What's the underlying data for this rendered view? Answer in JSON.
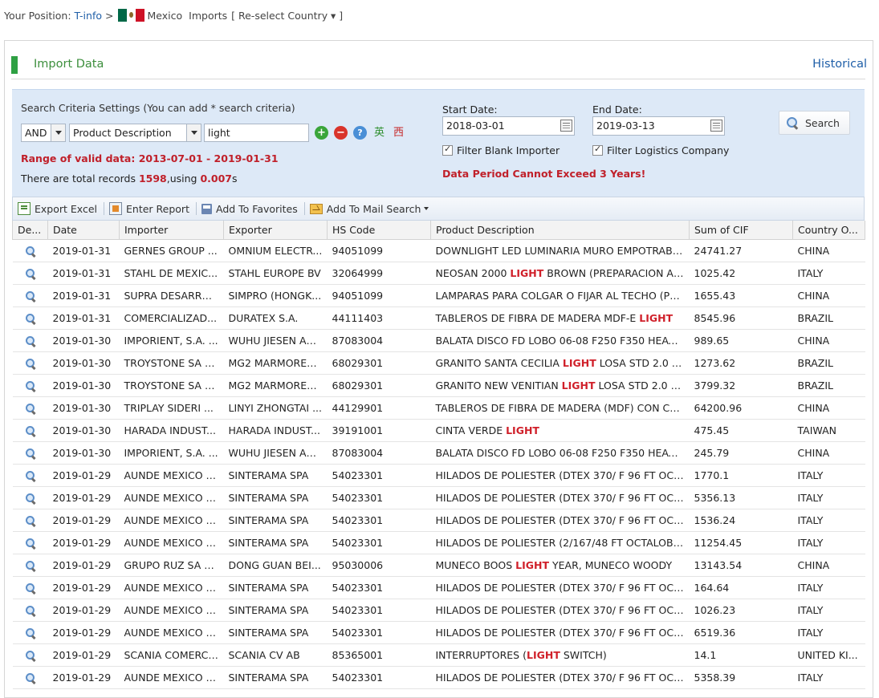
{
  "breadcrumb": {
    "prefix": "Your Position:",
    "home": "T-info",
    "separator": ">",
    "country": "Mexico",
    "section": "Imports",
    "reselect": "[ Re-select Country ▾ ]"
  },
  "panel": {
    "title": "Import Data",
    "historical": "Historical"
  },
  "criteria": {
    "title": "Search Criteria Settings (You can add * search criteria)",
    "logic_value": "AND",
    "field_value": "Product Description",
    "keyword_value": "light",
    "lang_en": "英",
    "lang_es": "西",
    "valid_range": "Range of valid data: 2013-07-01 - 2019-01-31",
    "records_prefix": "There are total records ",
    "records_count": "1598",
    "records_mid": ",using ",
    "records_time": "0.007",
    "records_suffix": "s",
    "start_label": "Start Date:",
    "start_value": "2018-03-01",
    "end_label": "End Date:",
    "end_value": "2019-03-13",
    "filter_blank": "Filter Blank Importer",
    "filter_logistics": "Filter Logistics Company",
    "period_warning": "Data Period Cannot Exceed 3 Years!",
    "search_label": "Search"
  },
  "toolbar": {
    "export": "Export Excel",
    "report": "Enter Report",
    "favorites": "Add To Favorites",
    "mail": "Add To Mail Search"
  },
  "table": {
    "headers": [
      "De...",
      "Date",
      "Importer",
      "Exporter",
      "HS Code",
      "Product Description",
      "Sum of CIF",
      "Country O..."
    ],
    "rows": [
      {
        "date": "2019-01-31",
        "importer": "GERNES GROUP ...",
        "exporter": "OMNIUM ELECTR...",
        "hs": "94051099",
        "desc": [
          "DOWNLIGHT LED LUMINARIA MURO EMPOTRABL..."
        ],
        "cif": "24741.27",
        "country": "CHINA"
      },
      {
        "date": "2019-01-31",
        "importer": "STAHL DE MEXIC...",
        "exporter": "STAHL EUROPE BV",
        "hs": "32064999",
        "desc": [
          "NEOSAN 2000 ",
          "LIGHT",
          " BROWN (PREPARACION A B..."
        ],
        "cif": "1025.42",
        "country": "ITALY"
      },
      {
        "date": "2019-01-31",
        "importer": "SUPRA DESARRO...",
        "exporter": "SIMPRO (HONGK...",
        "hs": "94051099",
        "desc": [
          "LAMPARAS PARA COLGAR O FIJAR AL TECHO (PE..."
        ],
        "cif": "1655.43",
        "country": "CHINA"
      },
      {
        "date": "2019-01-31",
        "importer": "COMERCIALIZAD...",
        "exporter": "DURATEX S.A.",
        "hs": "44111403",
        "desc": [
          "TABLEROS DE FIBRA DE MADERA MDF-E ",
          "LIGHT",
          ""
        ],
        "cif": "8545.96",
        "country": "BRAZIL"
      },
      {
        "date": "2019-01-30",
        "importer": "IMPORIENT, S.A. ...",
        "exporter": "WUHU JIESEN AU...",
        "hs": "87083004",
        "desc": [
          "BALATA DISCO FD LOBO 06-08 F250 F350 HEAVY ..."
        ],
        "cif": "989.65",
        "country": "CHINA"
      },
      {
        "date": "2019-01-30",
        "importer": "TROYSTONE SA D...",
        "exporter": "MG2 MARMORES ...",
        "hs": "68029301",
        "desc": [
          "GRANITO SANTA CECILIA ",
          "LIGHT",
          " LOSA STD 2.0 CM"
        ],
        "cif": "1273.62",
        "country": "BRAZIL"
      },
      {
        "date": "2019-01-30",
        "importer": "TROYSTONE SA D...",
        "exporter": "MG2 MARMORES ...",
        "hs": "68029301",
        "desc": [
          "GRANITO NEW VENITIAN ",
          "LIGHT",
          " LOSA STD 2.0 CM"
        ],
        "cif": "3799.32",
        "country": "BRAZIL"
      },
      {
        "date": "2019-01-30",
        "importer": "TRIPLAY SIDERI ...",
        "exporter": "LINYI ZHONGTAI ...",
        "hs": "44129901",
        "desc": [
          "TABLEROS DE FIBRA DE MADERA (MDF) CON CHA..."
        ],
        "cif": "64200.96",
        "country": "CHINA"
      },
      {
        "date": "2019-01-30",
        "importer": "HARADA INDUST...",
        "exporter": "HARADA INDUST...",
        "hs": "39191001",
        "desc": [
          "CINTA VERDE ",
          "LIGHT",
          ""
        ],
        "cif": "475.45",
        "country": "TAIWAN"
      },
      {
        "date": "2019-01-30",
        "importer": "IMPORIENT, S.A. ...",
        "exporter": "WUHU JIESEN AU...",
        "hs": "87083004",
        "desc": [
          "BALATA DISCO FD LOBO 06-08 F250 F350 HEAVY ..."
        ],
        "cif": "245.79",
        "country": "CHINA"
      },
      {
        "date": "2019-01-29",
        "importer": "AUNDE MEXICO S...",
        "exporter": "SINTERAMA SPA",
        "hs": "54023301",
        "desc": [
          "HILADOS DE POLIESTER (DTEX 370/ F 96 FT OCT..."
        ],
        "cif": "1770.1",
        "country": "ITALY"
      },
      {
        "date": "2019-01-29",
        "importer": "AUNDE MEXICO S...",
        "exporter": "SINTERAMA SPA",
        "hs": "54023301",
        "desc": [
          "HILADOS DE POLIESTER (DTEX 370/ F 96 FT OCT..."
        ],
        "cif": "5356.13",
        "country": "ITALY"
      },
      {
        "date": "2019-01-29",
        "importer": "AUNDE MEXICO S...",
        "exporter": "SINTERAMA SPA",
        "hs": "54023301",
        "desc": [
          "HILADOS DE POLIESTER (DTEX 370/ F 96 FT OCT..."
        ],
        "cif": "1536.24",
        "country": "ITALY"
      },
      {
        "date": "2019-01-29",
        "importer": "AUNDE MEXICO S...",
        "exporter": "SINTERAMA SPA",
        "hs": "54023301",
        "desc": [
          "HILADOS DE POLIESTER (2/167/48 FT OCTALOBA..."
        ],
        "cif": "11254.45",
        "country": "ITALY"
      },
      {
        "date": "2019-01-29",
        "importer": "GRUPO RUZ SA D...",
        "exporter": "DONG GUAN BEI...",
        "hs": "95030006",
        "desc": [
          "MUNECO BOOS ",
          "LIGHT",
          " YEAR, MUNECO WOODY"
        ],
        "cif": "13143.54",
        "country": "CHINA"
      },
      {
        "date": "2019-01-29",
        "importer": "AUNDE MEXICO S...",
        "exporter": "SINTERAMA SPA",
        "hs": "54023301",
        "desc": [
          "HILADOS DE POLIESTER (DTEX 370/ F 96 FT OCT..."
        ],
        "cif": "164.64",
        "country": "ITALY"
      },
      {
        "date": "2019-01-29",
        "importer": "AUNDE MEXICO S...",
        "exporter": "SINTERAMA SPA",
        "hs": "54023301",
        "desc": [
          "HILADOS DE POLIESTER (DTEX 370/ F 96 FT OCT..."
        ],
        "cif": "1026.23",
        "country": "ITALY"
      },
      {
        "date": "2019-01-29",
        "importer": "AUNDE MEXICO S...",
        "exporter": "SINTERAMA SPA",
        "hs": "54023301",
        "desc": [
          "HILADOS DE POLIESTER (DTEX 370/ F 96 FT OCT..."
        ],
        "cif": "6519.36",
        "country": "ITALY"
      },
      {
        "date": "2019-01-29",
        "importer": "SCANIA COMERCI...",
        "exporter": "SCANIA CV AB",
        "hs": "85365001",
        "desc": [
          "INTERRUPTORES (",
          "LIGHT",
          " SWITCH)"
        ],
        "cif": "14.1",
        "country": "UNITED KI..."
      },
      {
        "date": "2019-01-29",
        "importer": "AUNDE MEXICO S...",
        "exporter": "SINTERAMA SPA",
        "hs": "54023301",
        "desc": [
          "HILADOS DE POLIESTER (DTEX 370/ F 96 FT OCT..."
        ],
        "cif": "5358.39",
        "country": "ITALY"
      }
    ]
  },
  "colors": {
    "accent_green": "#2ea043",
    "highlight_red": "#d0202a",
    "criteria_bg": "#dde9f7",
    "link_blue": "#1f5fa8"
  }
}
